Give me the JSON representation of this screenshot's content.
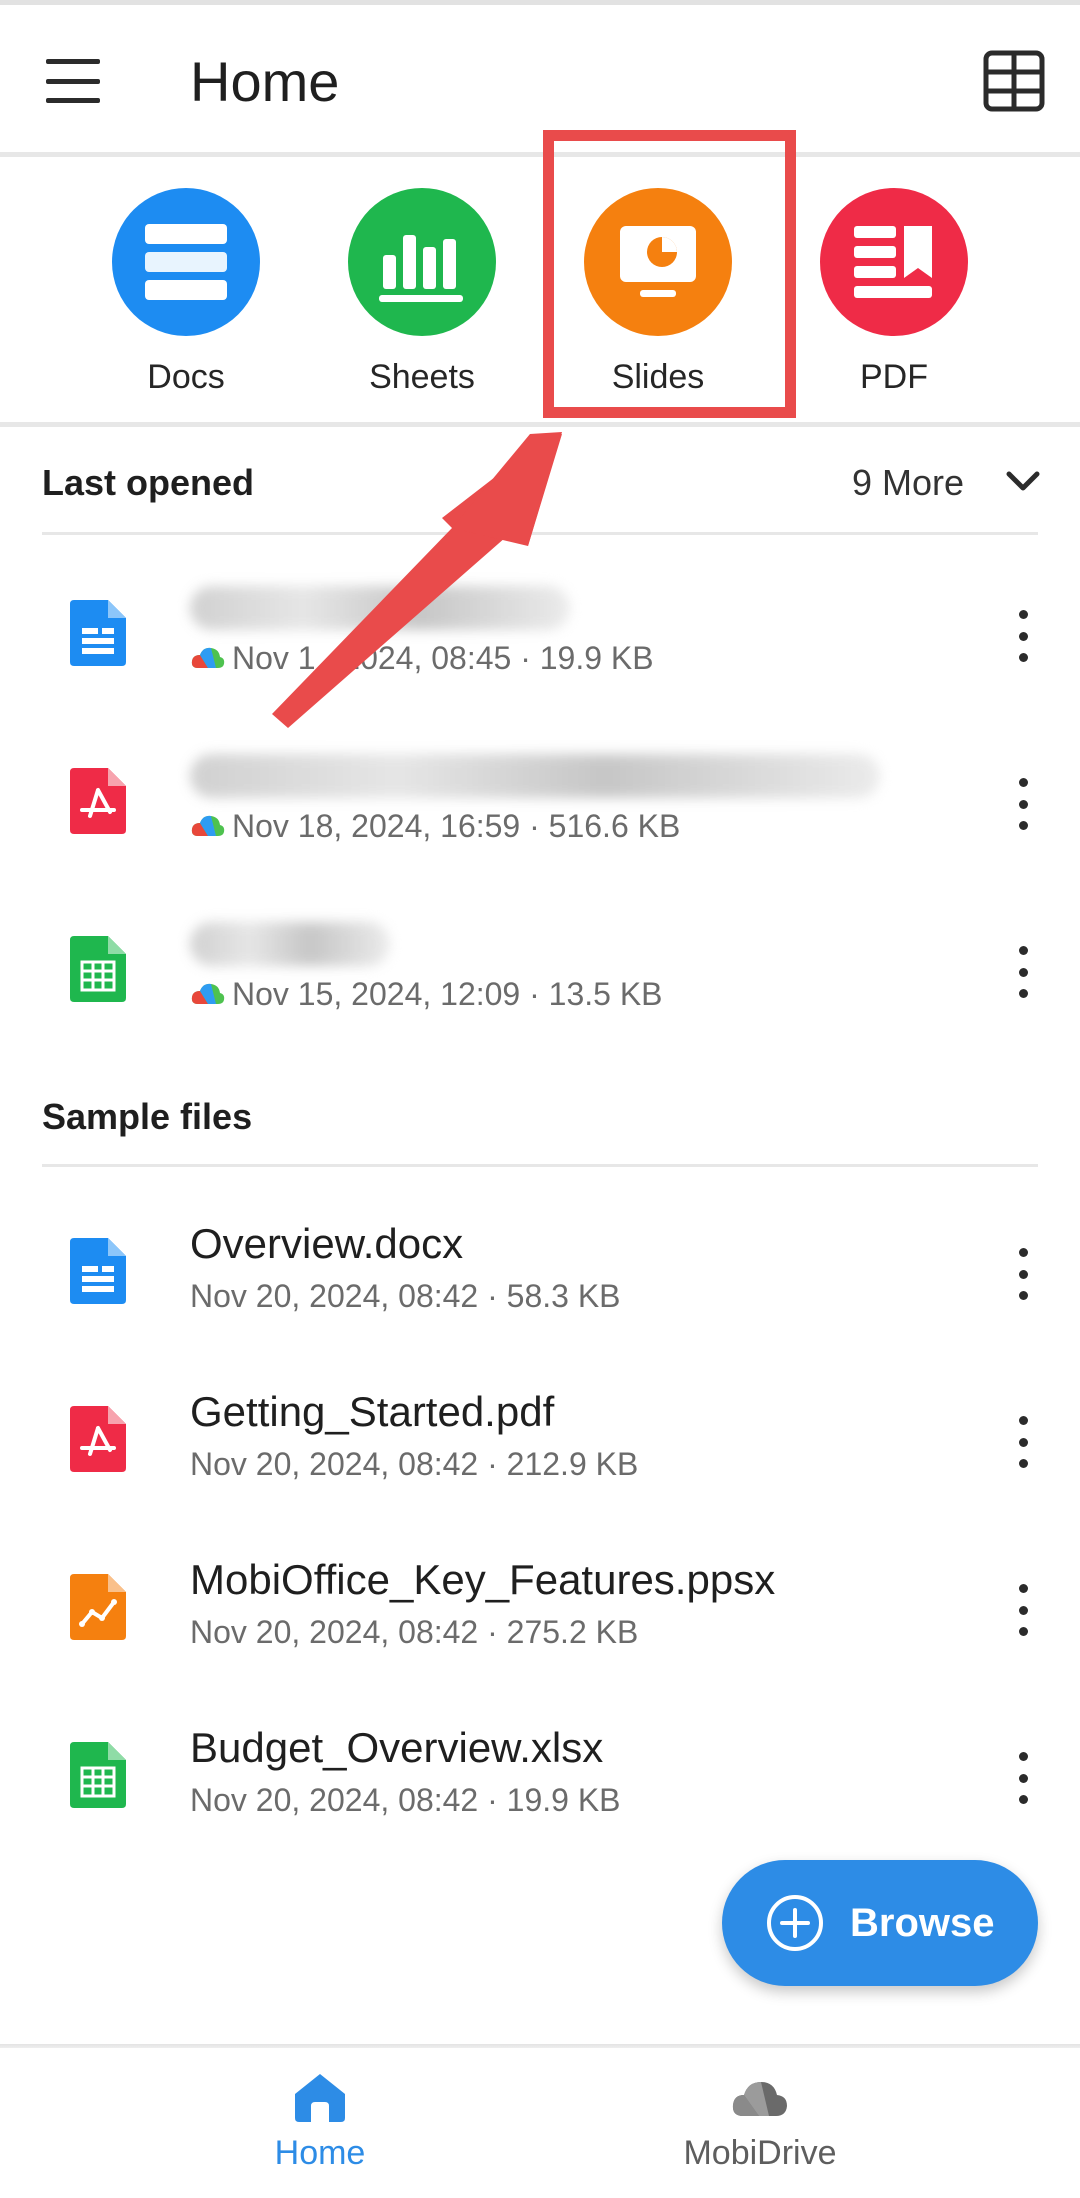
{
  "header": {
    "title": "Home"
  },
  "quick_actions": [
    {
      "label": "Docs",
      "color": "#1d8cf2"
    },
    {
      "label": "Sheets",
      "color": "#1fb74e"
    },
    {
      "label": "Slides",
      "color": "#f5800f"
    },
    {
      "label": "PDF",
      "color": "#ef2b47"
    }
  ],
  "last_opened": {
    "title": "Last opened",
    "more_label": "9 More",
    "files": [
      {
        "type": "doc",
        "meta": "Nov 1 , 2024, 08:45 · 19.9 KB"
      },
      {
        "type": "pdf",
        "meta": "Nov 18, 2024, 16:59 · 516.6 KB"
      },
      {
        "type": "sheet",
        "meta": "Nov 15, 2024, 12:09 · 13.5 KB"
      }
    ]
  },
  "sample_files": {
    "title": "Sample files",
    "files": [
      {
        "type": "doc",
        "name": "Overview.docx",
        "meta": "Nov 20, 2024, 08:42 · 58.3 KB"
      },
      {
        "type": "pdf",
        "name": "Getting_Started.pdf",
        "meta": "Nov 20, 2024, 08:42 · 212.9 KB"
      },
      {
        "type": "slide",
        "name": "MobiOffice_Key_Features.ppsx",
        "meta": "Nov 20, 2024, 08:42 · 275.2 KB"
      },
      {
        "type": "sheet",
        "name": "Budget_Overview.xlsx",
        "meta": "Nov 20, 2024, 08:42 · 19.9 KB"
      }
    ]
  },
  "browse": {
    "label": "Browse"
  },
  "bottom_nav": [
    {
      "label": "Home",
      "color": "#2d8ce6"
    },
    {
      "label": "MobiDrive",
      "color": "#5e5e5e"
    }
  ]
}
